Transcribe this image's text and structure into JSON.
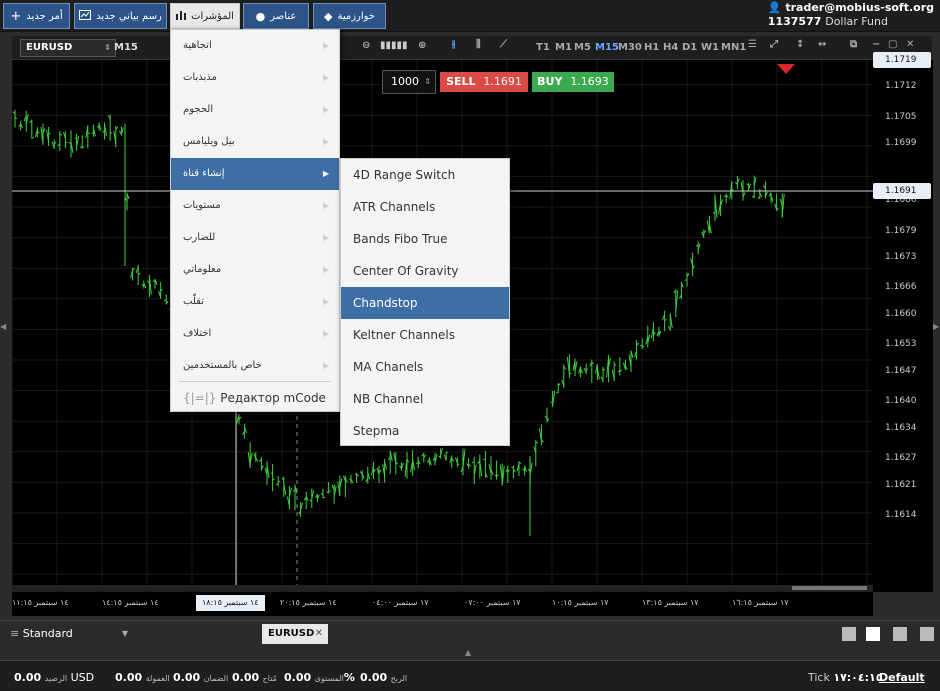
{
  "toolbar": {
    "new_order": "أمر جديد",
    "new_chart": "رسم بياني جديد",
    "indicators": "المؤشرات",
    "elements": "عناصر",
    "algorithm": "خوارزمية"
  },
  "account": {
    "email": "trader@mobius-soft.org",
    "number": "1137577",
    "type": "Dollar Fund"
  },
  "chart_toolbar": {
    "symbol": "EURUSD",
    "period": "M15",
    "timeframes": [
      "T1",
      "M1",
      "M5",
      "M15",
      "M30",
      "H1",
      "H4",
      "D1",
      "W1",
      "MN1"
    ],
    "selected_timeframe": "M15"
  },
  "trade": {
    "quantity": "1000",
    "sell_label": "SELL",
    "sell_price": "1.1691",
    "buy_label": "BUY",
    "buy_price": "1.1693"
  },
  "price_scale": {
    "ticks": [
      "1.1712",
      "1.1705",
      "1.1699",
      "1.1686",
      "1.1679",
      "1.1673",
      "1.1666",
      "1.1660",
      "1.1653",
      "1.1647",
      "1.1640",
      "1.1634",
      "1.1627",
      "1.1621",
      "1.1614"
    ],
    "current_price": "1.1691",
    "top_partial": "1.1719"
  },
  "time_scale": {
    "ticks": [
      "١٤ سبتمبر ١١:١٥",
      "١٤ سبتمبر ١٤:١٥",
      "١٤ سبتمبر ٢٠:١٥",
      "١٧ سبتمبر ٠٤:٠٠",
      "١٧ سبتمبر ٠٧:٠٠",
      "١٧ سبتمبر ١٠:١٥",
      "١٧ سبتمبر ١٣:١٥",
      "١٧ سبتمبر ١٦:١٥"
    ],
    "cursor_label": "١٤ سبتمبر ١٨:١٥"
  },
  "indicator_menu": {
    "items": [
      "اتجاهية",
      "مذبذبات",
      "الحجوم",
      "بيل ويليامس",
      "إنشاء قناة",
      "مستويات",
      "للضارب",
      "معلوماتي",
      "تقلّب",
      "اختلاف",
      "خاص بالمستخدمين"
    ],
    "highlighted": "إنشاء قناة",
    "editor": "Редактор mCode"
  },
  "channel_menu": {
    "items": [
      "4D Range Switch",
      "ATR Channels",
      "Bands Fibo True",
      "Center Of Gravity",
      "Chandstop",
      "Keltner Channels",
      "MA Chanels",
      "NB Channel",
      "Stepma"
    ],
    "highlighted": "Chandstop"
  },
  "bottom": {
    "workspace": "Standard",
    "tab": "EURUSD"
  },
  "status": {
    "balance_value": "0.00",
    "balance_label": "الرصيد",
    "currency": "USD",
    "commission_value": "0.00",
    "commission_label": "العمولة",
    "margin_value": "0.00",
    "margin_label": "الضمان",
    "available_value": "0.00",
    "available_label": "مُتاح",
    "level_value": "0.00",
    "level_label": "المستوى",
    "level_unit": "%",
    "profit_value": "0.00",
    "profit_label": "الربح",
    "tick_label": "Tick",
    "tick_time": "١٧:٠٤:١٥",
    "scheme": "Default"
  },
  "colors": {
    "button_blue": "#2c5488",
    "menu_highlight": "#3e6ea6",
    "bar_green": "#3fd23f",
    "sell_red": "#d94b44",
    "buy_green": "#3aa94f"
  }
}
